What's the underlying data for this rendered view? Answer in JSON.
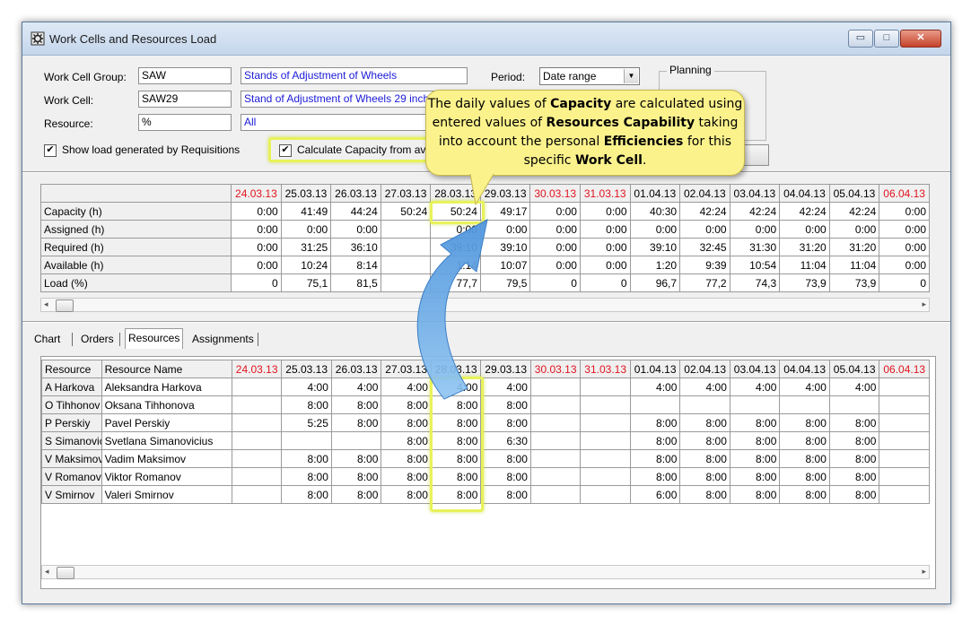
{
  "window": {
    "title": "Work Cells and Resources Load",
    "buttons": {
      "minimize": "▭",
      "maximize": "□",
      "close": "✕"
    }
  },
  "filters": {
    "work_cell_group_label": "Work Cell Group:",
    "work_cell_group_code": "SAW",
    "work_cell_group_name": "Stands of Adjustment of Wheels",
    "work_cell_label": "Work Cell:",
    "work_cell_code": "SAW29",
    "work_cell_name": "Stand of Adjustment of Wheels 29 inch",
    "resource_label": "Resource:",
    "resource_code": "%",
    "resource_name": "All",
    "show_load_label": "Show load generated by Requisitions",
    "show_load_checked": "✔",
    "calc_capacity_label": "Calculate Capacity from ava",
    "calc_capacity_checked": "✔",
    "period_label": "Period:",
    "period_value": "Date range",
    "planning_label": "Planning"
  },
  "callout": {
    "p1": "The daily values of ",
    "b1": "Capacity",
    "p2": " are calculated using entered values of ",
    "b2": "Resources Capability",
    "p3": " taking into account the personal ",
    "b3": "Efficiencies",
    "p4": " for this specific ",
    "b4": "Work Cell",
    "p5": "."
  },
  "top_table": {
    "dates": [
      "24.03.13",
      "25.03.13",
      "26.03.13",
      "27.03.13",
      "28.03.13",
      "29.03.13",
      "30.03.13",
      "31.03.13",
      "01.04.13",
      "02.04.13",
      "03.04.13",
      "04.04.13",
      "05.04.13",
      "06.04.13"
    ],
    "red_dates": [
      0,
      6,
      7,
      13
    ],
    "rows": [
      {
        "label": "Capacity (h)",
        "values": [
          "0:00",
          "41:49",
          "44:24",
          "50:24",
          "50:24",
          "49:17",
          "0:00",
          "0:00",
          "40:30",
          "42:24",
          "42:24",
          "42:24",
          "42:24",
          "0:00"
        ]
      },
      {
        "label": "Assigned (h)",
        "values": [
          "0:00",
          "0:00",
          "0:00",
          "",
          "0:00",
          "0:00",
          "0:00",
          "0:00",
          "0:00",
          "0:00",
          "0:00",
          "0:00",
          "0:00",
          "0:00"
        ]
      },
      {
        "label": "Required (h)",
        "values": [
          "0:00",
          "31:25",
          "36:10",
          "",
          "39:10",
          "39:10",
          "0:00",
          "0:00",
          "39:10",
          "32:45",
          "31:30",
          "31:20",
          "31:20",
          "0:00"
        ]
      },
      {
        "label": "Available (h)",
        "values": [
          "0:00",
          "10:24",
          "8:14",
          "",
          "1:14",
          "10:07",
          "0:00",
          "0:00",
          "1:20",
          "9:39",
          "10:54",
          "11:04",
          "11:04",
          "0:00"
        ]
      },
      {
        "label": "Load (%)",
        "values": [
          "0",
          "75,1",
          "81,5",
          "",
          "77,7",
          "79,5",
          "0",
          "0",
          "96,7",
          "77,2",
          "74,3",
          "73,9",
          "73,9",
          "0"
        ]
      }
    ]
  },
  "tabs": [
    "Chart",
    "Orders",
    "Resources",
    "Assignments"
  ],
  "bottom_table": {
    "header_resource": "Resource",
    "header_resource_name": "Resource Name",
    "rows": [
      {
        "resource": "A Harkova",
        "name": "Aleksandra Harkova",
        "values": [
          "",
          "4:00",
          "4:00",
          "4:00",
          "4:00",
          "4:00",
          "",
          "",
          "4:00",
          "4:00",
          "4:00",
          "4:00",
          "4:00",
          ""
        ]
      },
      {
        "resource": "O Tihhonov",
        "name": "Oksana Tihhonova",
        "values": [
          "",
          "8:00",
          "8:00",
          "8:00",
          "8:00",
          "8:00",
          "",
          "",
          "",
          "",
          "",
          "",
          "",
          ""
        ]
      },
      {
        "resource": "P Perskiy",
        "name": "Pavel Perskiy",
        "values": [
          "",
          "5:25",
          "8:00",
          "8:00",
          "8:00",
          "8:00",
          "",
          "",
          "8:00",
          "8:00",
          "8:00",
          "8:00",
          "8:00",
          ""
        ]
      },
      {
        "resource": "S Simanovic",
        "name": "Svetlana Simanovicius",
        "values": [
          "",
          "",
          "",
          "8:00",
          "8:00",
          "6:30",
          "",
          "",
          "8:00",
          "8:00",
          "8:00",
          "8:00",
          "8:00",
          ""
        ]
      },
      {
        "resource": "V Maksimov",
        "name": "Vadim Maksimov",
        "values": [
          "",
          "8:00",
          "8:00",
          "8:00",
          "8:00",
          "8:00",
          "",
          "",
          "8:00",
          "8:00",
          "8:00",
          "8:00",
          "8:00",
          ""
        ]
      },
      {
        "resource": "V Romanov",
        "name": "Viktor Romanov",
        "values": [
          "",
          "8:00",
          "8:00",
          "8:00",
          "8:00",
          "8:00",
          "",
          "",
          "8:00",
          "8:00",
          "8:00",
          "8:00",
          "8:00",
          ""
        ]
      },
      {
        "resource": "V Smirnov",
        "name": "Valeri Smirnov",
        "values": [
          "",
          "8:00",
          "8:00",
          "8:00",
          "8:00",
          "8:00",
          "",
          "",
          "6:00",
          "8:00",
          "8:00",
          "8:00",
          "8:00",
          ""
        ]
      }
    ]
  },
  "colors": {
    "weekend_red": "#e0141e",
    "highlight": "#e8f25a",
    "callout_bg": "#fbf28c",
    "arrow_blue": "#6aaee8"
  }
}
